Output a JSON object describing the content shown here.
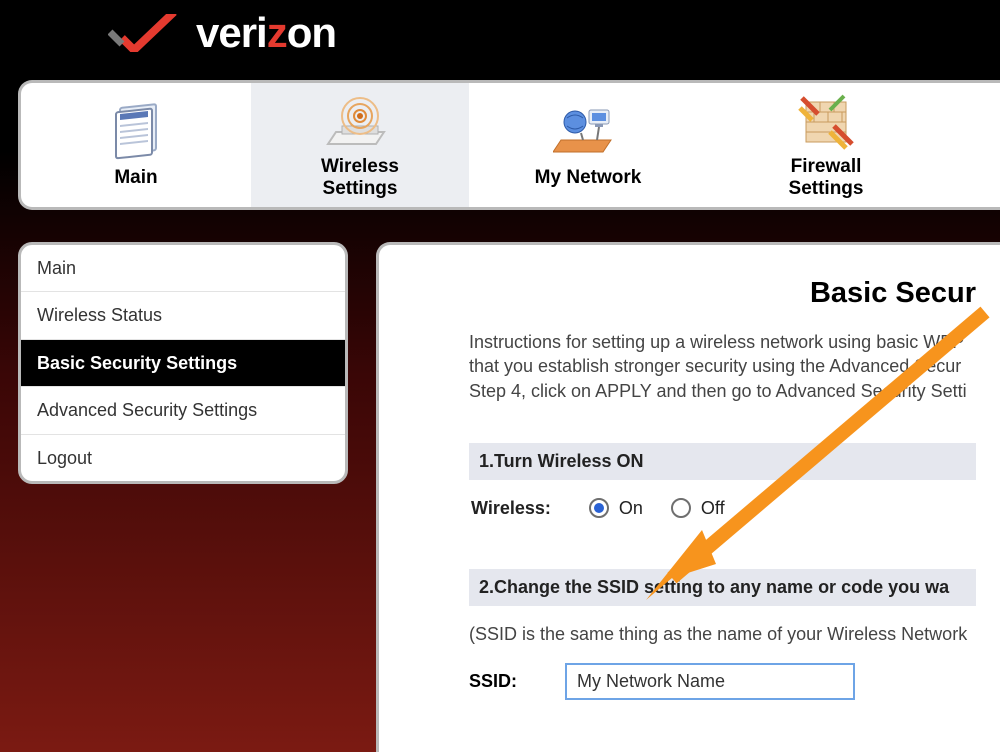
{
  "brand": {
    "name_pre": "veri",
    "name_z": "z",
    "name_post": "on"
  },
  "topnav": {
    "main": "Main",
    "wireless_l1": "Wireless",
    "wireless_l2": "Settings",
    "network": "My Network",
    "firewall_l1": "Firewall",
    "firewall_l2": "Settings"
  },
  "sidebar": {
    "items": [
      {
        "label": "Main"
      },
      {
        "label": "Wireless Status"
      },
      {
        "label": "Basic Security Settings"
      },
      {
        "label": "Advanced Security Settings"
      },
      {
        "label": "Logout"
      }
    ]
  },
  "content": {
    "title": "Basic Secur",
    "instructions_l1": "Instructions for setting up a wireless network using basic WEP",
    "instructions_l2": "that you establish stronger security using the Advanced Secur",
    "instructions_l3": "Step 4, click on APPLY and then go to Advanced Security Setti",
    "step1": {
      "header": "1.Turn Wireless ON",
      "label": "Wireless:",
      "on": "On",
      "off": "Off",
      "value": "on"
    },
    "step2": {
      "header": "2.Change the SSID setting to any name or code you wa",
      "note": "(SSID is the same thing as the name of your Wireless Network",
      "label": "SSID:",
      "value": "My Network Name"
    }
  }
}
